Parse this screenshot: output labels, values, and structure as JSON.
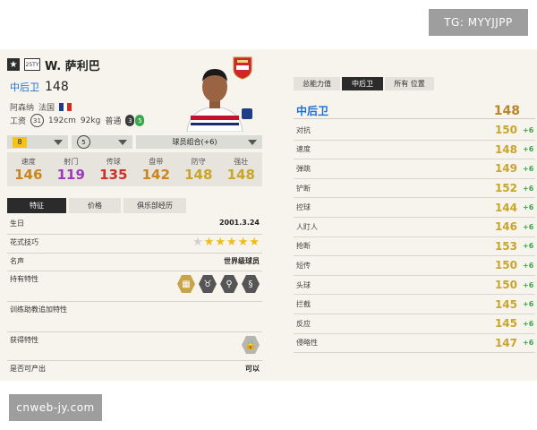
{
  "watermark_top": "TG: MYYJJPP",
  "watermark_bottom": "cnweb-jy.com",
  "player": {
    "star_icon": "star-icon",
    "season_badge": "25TY",
    "name": "W. 萨利巴",
    "position": "中后卫",
    "overall": "148",
    "club": "阿森纳",
    "nation": "法国",
    "wage_label": "工资",
    "wage": "31",
    "height": "192cm",
    "weight": "92kg",
    "body_type": "普通",
    "weak_foot_left": "3",
    "weak_foot_right": "5"
  },
  "selectors": {
    "level": "8",
    "rank": "5",
    "team_chem": "球员组合(+6)"
  },
  "stats": [
    {
      "label": "速度",
      "value": "146",
      "color": "#c9851e"
    },
    {
      "label": "射门",
      "value": "119",
      "color": "#9b3bb8"
    },
    {
      "label": "传球",
      "value": "135",
      "color": "#c8322b"
    },
    {
      "label": "盘带",
      "value": "142",
      "color": "#c9851e"
    },
    {
      "label": "防守",
      "value": "148",
      "color": "#c9a52c"
    },
    {
      "label": "强壮",
      "value": "148",
      "color": "#c9a52c"
    }
  ],
  "left_tabs": [
    {
      "label": "特征"
    },
    {
      "label": "价格"
    },
    {
      "label": "俱乐部经历"
    }
  ],
  "details": {
    "birth_label": "生日",
    "birth_value": "2001.3.24",
    "skill_label": "花式技巧",
    "skill_stars": 5,
    "fame_label": "名声",
    "fame_value": "世界级球员",
    "traits_label": "持有特性",
    "training_label": "训练助教追加特性",
    "acquired_label": "获得特性",
    "sellable_label": "是否可产出",
    "sellable_value": "可以"
  },
  "right_tabs": [
    {
      "label": "总能力值"
    },
    {
      "label": "中后卫"
    },
    {
      "label": "所有 位置"
    }
  ],
  "summary": {
    "position": "中后卫",
    "value": "148"
  },
  "attributes": [
    {
      "label": "对抗",
      "value": "150",
      "bonus": "+6"
    },
    {
      "label": "速度",
      "value": "148",
      "bonus": "+6"
    },
    {
      "label": "弹跳",
      "value": "149",
      "bonus": "+6"
    },
    {
      "label": "铲断",
      "value": "152",
      "bonus": "+6"
    },
    {
      "label": "控球",
      "value": "144",
      "bonus": "+6"
    },
    {
      "label": "人盯人",
      "value": "146",
      "bonus": "+6"
    },
    {
      "label": "抢断",
      "value": "153",
      "bonus": "+6"
    },
    {
      "label": "短传",
      "value": "150",
      "bonus": "+6"
    },
    {
      "label": "头球",
      "value": "150",
      "bonus": "+6"
    },
    {
      "label": "拦截",
      "value": "145",
      "bonus": "+6"
    },
    {
      "label": "反应",
      "value": "145",
      "bonus": "+6"
    },
    {
      "label": "侵略性",
      "value": "147",
      "bonus": "+6"
    }
  ]
}
